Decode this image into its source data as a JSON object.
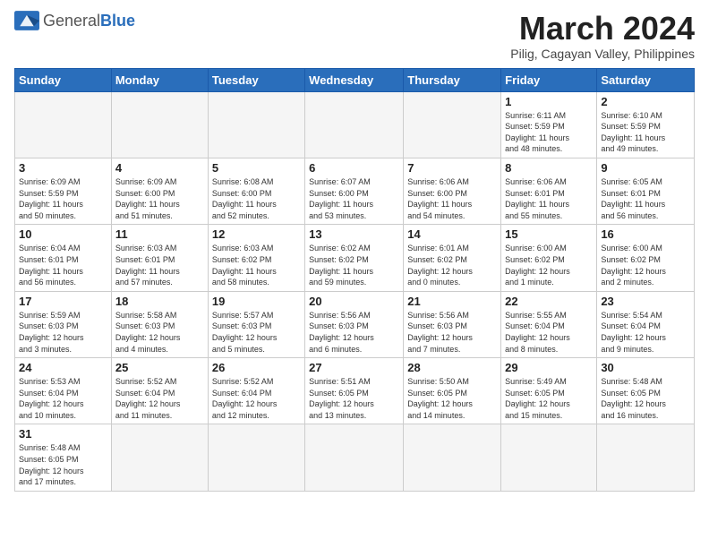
{
  "header": {
    "logo_general": "General",
    "logo_blue": "Blue",
    "title": "March 2024",
    "location": "Pilig, Cagayan Valley, Philippines"
  },
  "weekdays": [
    "Sunday",
    "Monday",
    "Tuesday",
    "Wednesday",
    "Thursday",
    "Friday",
    "Saturday"
  ],
  "weeks": [
    [
      {
        "day": "",
        "info": ""
      },
      {
        "day": "",
        "info": ""
      },
      {
        "day": "",
        "info": ""
      },
      {
        "day": "",
        "info": ""
      },
      {
        "day": "",
        "info": ""
      },
      {
        "day": "1",
        "info": "Sunrise: 6:11 AM\nSunset: 5:59 PM\nDaylight: 11 hours\nand 48 minutes."
      },
      {
        "day": "2",
        "info": "Sunrise: 6:10 AM\nSunset: 5:59 PM\nDaylight: 11 hours\nand 49 minutes."
      }
    ],
    [
      {
        "day": "3",
        "info": "Sunrise: 6:09 AM\nSunset: 5:59 PM\nDaylight: 11 hours\nand 50 minutes."
      },
      {
        "day": "4",
        "info": "Sunrise: 6:09 AM\nSunset: 6:00 PM\nDaylight: 11 hours\nand 51 minutes."
      },
      {
        "day": "5",
        "info": "Sunrise: 6:08 AM\nSunset: 6:00 PM\nDaylight: 11 hours\nand 52 minutes."
      },
      {
        "day": "6",
        "info": "Sunrise: 6:07 AM\nSunset: 6:00 PM\nDaylight: 11 hours\nand 53 minutes."
      },
      {
        "day": "7",
        "info": "Sunrise: 6:06 AM\nSunset: 6:00 PM\nDaylight: 11 hours\nand 54 minutes."
      },
      {
        "day": "8",
        "info": "Sunrise: 6:06 AM\nSunset: 6:01 PM\nDaylight: 11 hours\nand 55 minutes."
      },
      {
        "day": "9",
        "info": "Sunrise: 6:05 AM\nSunset: 6:01 PM\nDaylight: 11 hours\nand 56 minutes."
      }
    ],
    [
      {
        "day": "10",
        "info": "Sunrise: 6:04 AM\nSunset: 6:01 PM\nDaylight: 11 hours\nand 56 minutes."
      },
      {
        "day": "11",
        "info": "Sunrise: 6:03 AM\nSunset: 6:01 PM\nDaylight: 11 hours\nand 57 minutes."
      },
      {
        "day": "12",
        "info": "Sunrise: 6:03 AM\nSunset: 6:02 PM\nDaylight: 11 hours\nand 58 minutes."
      },
      {
        "day": "13",
        "info": "Sunrise: 6:02 AM\nSunset: 6:02 PM\nDaylight: 11 hours\nand 59 minutes."
      },
      {
        "day": "14",
        "info": "Sunrise: 6:01 AM\nSunset: 6:02 PM\nDaylight: 12 hours\nand 0 minutes."
      },
      {
        "day": "15",
        "info": "Sunrise: 6:00 AM\nSunset: 6:02 PM\nDaylight: 12 hours\nand 1 minute."
      },
      {
        "day": "16",
        "info": "Sunrise: 6:00 AM\nSunset: 6:02 PM\nDaylight: 12 hours\nand 2 minutes."
      }
    ],
    [
      {
        "day": "17",
        "info": "Sunrise: 5:59 AM\nSunset: 6:03 PM\nDaylight: 12 hours\nand 3 minutes."
      },
      {
        "day": "18",
        "info": "Sunrise: 5:58 AM\nSunset: 6:03 PM\nDaylight: 12 hours\nand 4 minutes."
      },
      {
        "day": "19",
        "info": "Sunrise: 5:57 AM\nSunset: 6:03 PM\nDaylight: 12 hours\nand 5 minutes."
      },
      {
        "day": "20",
        "info": "Sunrise: 5:56 AM\nSunset: 6:03 PM\nDaylight: 12 hours\nand 6 minutes."
      },
      {
        "day": "21",
        "info": "Sunrise: 5:56 AM\nSunset: 6:03 PM\nDaylight: 12 hours\nand 7 minutes."
      },
      {
        "day": "22",
        "info": "Sunrise: 5:55 AM\nSunset: 6:04 PM\nDaylight: 12 hours\nand 8 minutes."
      },
      {
        "day": "23",
        "info": "Sunrise: 5:54 AM\nSunset: 6:04 PM\nDaylight: 12 hours\nand 9 minutes."
      }
    ],
    [
      {
        "day": "24",
        "info": "Sunrise: 5:53 AM\nSunset: 6:04 PM\nDaylight: 12 hours\nand 10 minutes."
      },
      {
        "day": "25",
        "info": "Sunrise: 5:52 AM\nSunset: 6:04 PM\nDaylight: 12 hours\nand 11 minutes."
      },
      {
        "day": "26",
        "info": "Sunrise: 5:52 AM\nSunset: 6:04 PM\nDaylight: 12 hours\nand 12 minutes."
      },
      {
        "day": "27",
        "info": "Sunrise: 5:51 AM\nSunset: 6:05 PM\nDaylight: 12 hours\nand 13 minutes."
      },
      {
        "day": "28",
        "info": "Sunrise: 5:50 AM\nSunset: 6:05 PM\nDaylight: 12 hours\nand 14 minutes."
      },
      {
        "day": "29",
        "info": "Sunrise: 5:49 AM\nSunset: 6:05 PM\nDaylight: 12 hours\nand 15 minutes."
      },
      {
        "day": "30",
        "info": "Sunrise: 5:48 AM\nSunset: 6:05 PM\nDaylight: 12 hours\nand 16 minutes."
      }
    ],
    [
      {
        "day": "31",
        "info": "Sunrise: 5:48 AM\nSunset: 6:05 PM\nDaylight: 12 hours\nand 17 minutes."
      },
      {
        "day": "",
        "info": ""
      },
      {
        "day": "",
        "info": ""
      },
      {
        "day": "",
        "info": ""
      },
      {
        "day": "",
        "info": ""
      },
      {
        "day": "",
        "info": ""
      },
      {
        "day": "",
        "info": ""
      }
    ]
  ]
}
